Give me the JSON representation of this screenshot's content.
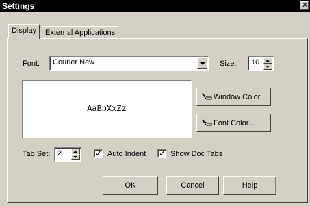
{
  "window": {
    "title": "Settings",
    "close_symbol": "✕"
  },
  "tabs": [
    {
      "label": "Display",
      "active": true
    },
    {
      "label": "External Applications",
      "active": false
    }
  ],
  "font": {
    "label": "Font:",
    "value": "Courier New"
  },
  "size": {
    "label": "Size:",
    "value": "10"
  },
  "preview": {
    "sample_text": "AaBbXxZz"
  },
  "buttons": {
    "window_color": "Window Color...",
    "font_color": "Font Color...",
    "ok": "OK",
    "cancel": "Cancel",
    "help": "Help"
  },
  "tab_set": {
    "label": "Tab Set:",
    "value": "2"
  },
  "checkboxes": {
    "auto_indent": {
      "label": "Auto Indent",
      "checked": true
    },
    "show_doc_tabs": {
      "label": "Show Doc Tabs",
      "checked": true
    }
  },
  "icons": {
    "color_icon": "paint-brush-icon"
  }
}
